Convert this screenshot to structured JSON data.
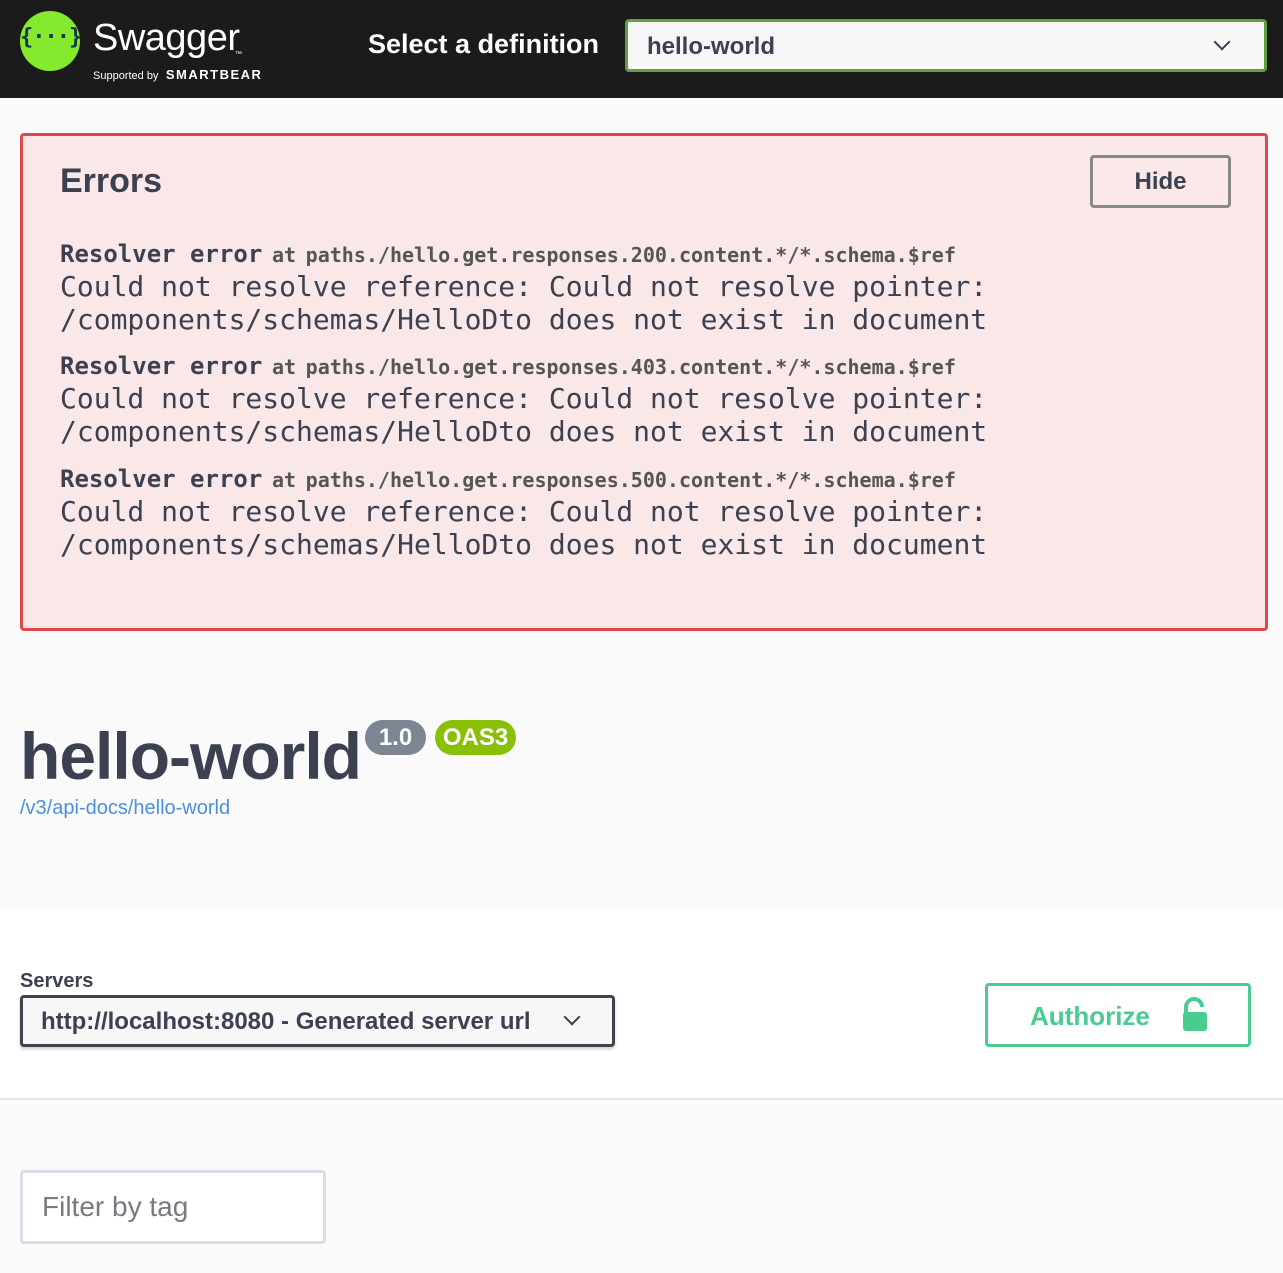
{
  "topbar": {
    "logo_text": "Swagger",
    "logo_tm": "™",
    "logo_glyph": "{···}",
    "supported_by": "Supported by",
    "brand": "SMARTBEAR",
    "select_label": "Select a definition",
    "selected_definition": "hello-world"
  },
  "errors": {
    "title": "Errors",
    "hide_label": "Hide",
    "items": [
      {
        "head": "Resolver error",
        "at": "at",
        "path": "paths./hello.get.responses.200.content.*/*.schema.$ref",
        "line1": "Could not resolve reference: Could not resolve pointer:",
        "line2": "/components/schemas/HelloDto does not exist in document"
      },
      {
        "head": "Resolver error",
        "at": "at",
        "path": "paths./hello.get.responses.403.content.*/*.schema.$ref",
        "line1": "Could not resolve reference: Could not resolve pointer:",
        "line2": "/components/schemas/HelloDto does not exist in document"
      },
      {
        "head": "Resolver error",
        "at": "at",
        "path": "paths./hello.get.responses.500.content.*/*.schema.$ref",
        "line1": "Could not resolve reference: Could not resolve pointer:",
        "line2": "/components/schemas/HelloDto does not exist in document"
      }
    ]
  },
  "info": {
    "title": "hello-world",
    "version": "1.0",
    "oas_badge": "OAS3",
    "spec_url": "/v3/api-docs/hello-world"
  },
  "servers": {
    "label": "Servers",
    "selected": "http://localhost:8080 - Generated server url"
  },
  "authorize": {
    "label": "Authorize",
    "icon": "unlocked-lock-icon"
  },
  "filter": {
    "placeholder": "Filter by tag"
  },
  "colors": {
    "topbar_bg": "#1b1b1b",
    "logo_green": "#85ea2d",
    "select_border": "#62a03f",
    "error_bg": "#fae7e7",
    "error_border": "#e0484b",
    "version_badge": "#7d8492",
    "oas_badge": "#89bf04",
    "link": "#4990e2",
    "authorize": "#49cc90"
  }
}
